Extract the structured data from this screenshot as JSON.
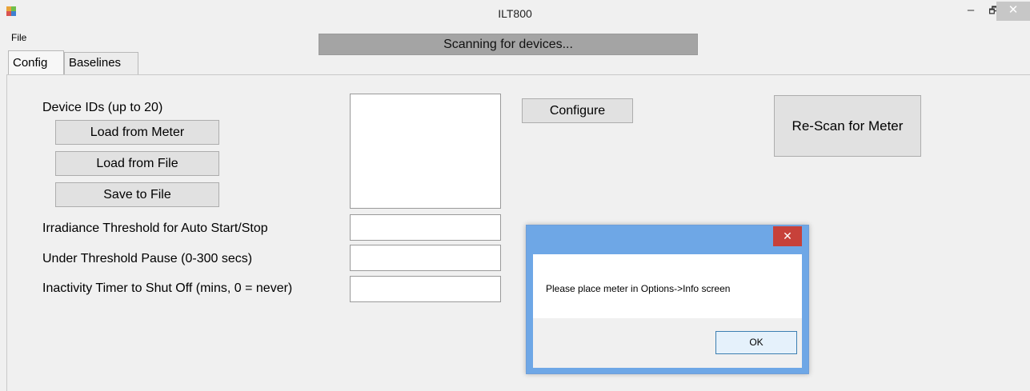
{
  "window": {
    "title": "ILT800",
    "minimize_glyph": "–",
    "restore_glyph": "🗗",
    "close_glyph": "✕"
  },
  "menu": {
    "file": "File"
  },
  "status": {
    "text": "Scanning for devices...",
    "progress_percent": 100
  },
  "tabs": [
    {
      "label": "Config",
      "active": true
    },
    {
      "label": "Baselines",
      "active": false
    }
  ],
  "config": {
    "device_ids_label": "Device IDs (up to 20)",
    "device_ids_value": "",
    "load_from_meter": "Load from Meter",
    "load_from_file": "Load from File",
    "save_to_file": "Save to File",
    "configure": "Configure",
    "rescan": "Re-Scan for Meter",
    "fields": [
      {
        "label": "Irradiance Threshold for Auto Start/Stop",
        "value": ""
      },
      {
        "label": "Under Threshold Pause (0-300 secs)",
        "value": ""
      },
      {
        "label": "Inactivity Timer to Shut Off (mins, 0 = never)",
        "value": ""
      }
    ]
  },
  "dialog": {
    "message": "Please place meter in Options->Info screen",
    "ok": "OK",
    "close_glyph": "✕"
  },
  "colors": {
    "background": "#f0f0f0",
    "progress_bar": "#a9a9a9",
    "dialog_frame": "#6ea7e6",
    "dialog_close": "#c7413a"
  }
}
